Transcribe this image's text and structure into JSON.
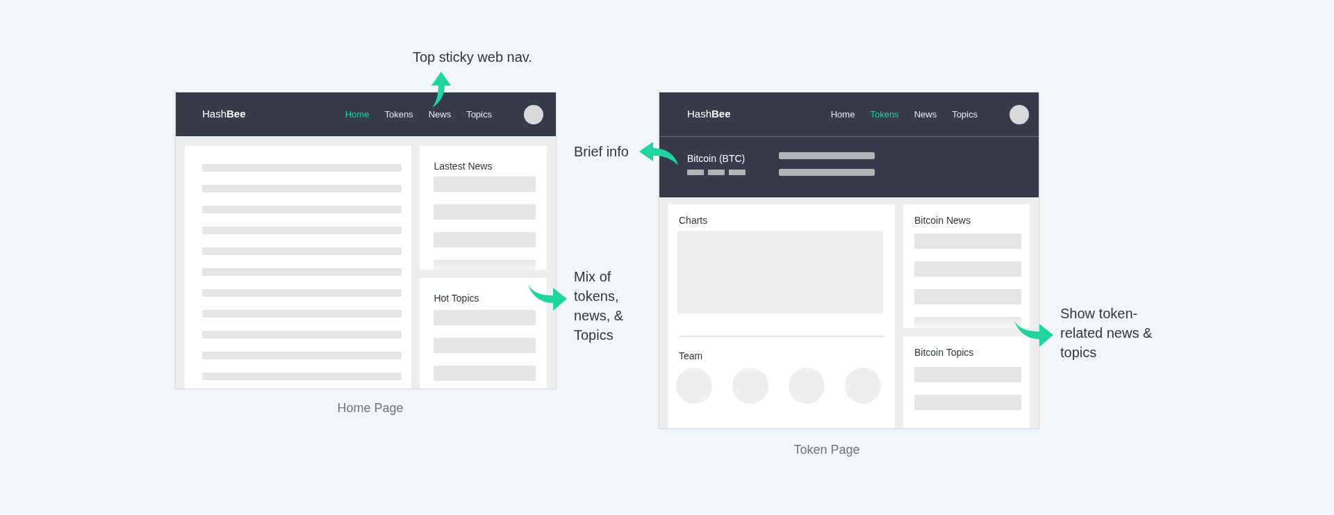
{
  "annotations": [
    {
      "text": "Top sticky web nav."
    },
    {
      "text": "Brief info"
    },
    {
      "text": "Mix of tokens, news, & Topics"
    },
    {
      "text": "Show token-related news & topics"
    }
  ],
  "home_page": {
    "nav": {
      "brand": "Hash**Bee**",
      "links": [
        {
          "label": "Home",
          "selected": true
        },
        {
          "label": "Tokens",
          "selected": false
        },
        {
          "label": "News",
          "selected": false
        },
        {
          "label": "Topics",
          "selected": false
        }
      ]
    },
    "side_panels": [
      {
        "title": "Lastest News"
      },
      {
        "title": "Hot Topics"
      }
    ],
    "caption": "Home Page"
  },
  "token_page": {
    "nav": {
      "brand": "Hash**Bee**",
      "links": [
        {
          "label": "Home",
          "selected": false
        },
        {
          "label": "Tokens",
          "selected": true
        },
        {
          "label": "News",
          "selected": false
        },
        {
          "label": "Topics",
          "selected": false
        }
      ]
    },
    "token_name": "Bitcoin (BTC)",
    "main_panels": [
      {
        "title": "Charts"
      },
      {
        "title": "Team"
      }
    ],
    "side_panels": [
      {
        "title": "Bitcoin News"
      },
      {
        "title": "Bitcoin Topics"
      }
    ],
    "caption": "Token Page"
  }
}
